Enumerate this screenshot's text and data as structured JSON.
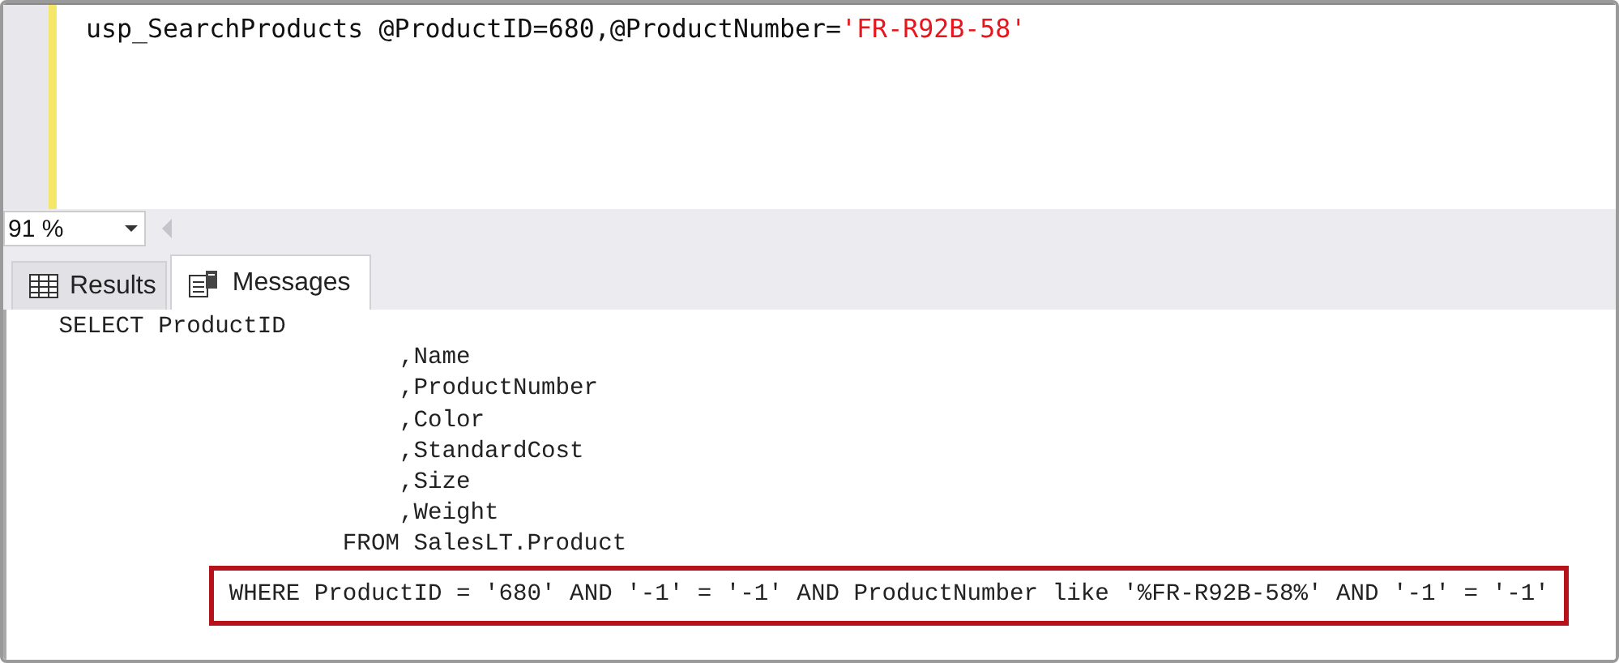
{
  "editor": {
    "lines": [
      [
        {
          "kind": "plain",
          "text": "usp_SearchProducts @ProductID=680,@ProductNumber="
        },
        {
          "kind": "string",
          "text": "'FR-R92B-58'"
        }
      ]
    ]
  },
  "zoom": {
    "value": "91 %"
  },
  "tabs": [
    {
      "label": "Results",
      "kind": "grid",
      "selected": false
    },
    {
      "label": "Messages",
      "kind": "messages",
      "selected": true
    }
  ],
  "messages": [
    {
      "text": "   SELECT ProductID",
      "highlighted": false
    },
    {
      "text": "                           ,Name",
      "highlighted": false
    },
    {
      "text": "                           ,ProductNumber",
      "highlighted": false
    },
    {
      "text": "                           ,Color",
      "highlighted": false
    },
    {
      "text": "                           ,StandardCost",
      "highlighted": false
    },
    {
      "text": "                           ,Size",
      "highlighted": false
    },
    {
      "text": "                           ,Weight",
      "highlighted": false
    },
    {
      "text": "                       FROM SalesLT.Product",
      "highlighted": false
    },
    {
      "text": "               WHERE ProductID = '680' AND '-1' = '-1' AND ProductNumber like '%FR-R92B-58%' AND '-1' = '-1'",
      "highlighted": true
    }
  ]
}
